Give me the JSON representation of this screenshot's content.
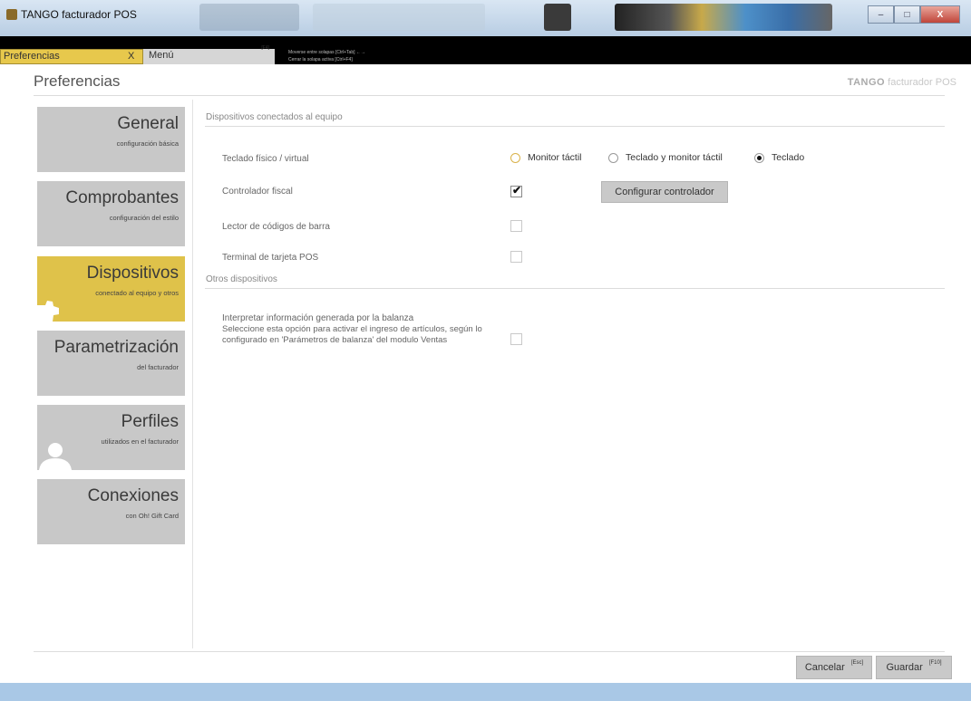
{
  "window": {
    "title": "TANGO facturador POS",
    "minimize": "–",
    "maximize": "□",
    "close": "X"
  },
  "tabs": {
    "active_label": "Preferencias",
    "active_close": "X",
    "menu_label": "Menú",
    "menu_key": "[F4]",
    "hint_1": "Moverse entre solapas [Ctrl+Tab] ←→",
    "hint_2": "Cerrar la solapa activa [Ctrl+F4]"
  },
  "page": {
    "title": "Preferencias",
    "brand_logo": "TANGO",
    "brand_text": "facturador POS"
  },
  "nav": [
    {
      "title": "General",
      "subtitle": "configuración básica"
    },
    {
      "title": "Comprobantes",
      "subtitle": "configuración del estilo"
    },
    {
      "title": "Dispositivos",
      "subtitle": "conectado al equipo y otros"
    },
    {
      "title": "Parametrización",
      "subtitle": "del facturador"
    },
    {
      "title": "Perfiles",
      "subtitle": "utilizados en el facturador"
    },
    {
      "title": "Conexiones",
      "subtitle": "con Oh! Gift Card"
    }
  ],
  "content": {
    "section_connected": "Dispositivos conectados al equipo",
    "teclado_label": "Teclado físico / virtual",
    "teclado_options": [
      "Monitor táctil",
      "Teclado y monitor táctil",
      "Teclado"
    ],
    "teclado_selected": "Teclado",
    "controlador_label": "Controlador fiscal",
    "controlador_checked": true,
    "configurar_button": "Configurar controlador",
    "lector_label": "Lector de códigos de barra",
    "lector_checked": false,
    "terminal_label": "Terminal de tarjeta POS",
    "terminal_checked": false,
    "section_other": "Otros dispositivos",
    "balanza_title": "Interpretar información generada por la balanza",
    "balanza_desc": "Seleccione esta opción para activar el ingreso de artículos, según lo configurado en 'Parámetros de balanza' del modulo Ventas",
    "balanza_checked": false,
    "check_mark": "✔"
  },
  "footer": {
    "cancel_label": "Cancelar",
    "cancel_key": "[Esc]",
    "save_label": "Guardar",
    "save_key": "[F10]"
  },
  "colors": {
    "accent": "#dfc24a",
    "card": "#c8c8c8",
    "statusbar": "#a9c8e6"
  }
}
